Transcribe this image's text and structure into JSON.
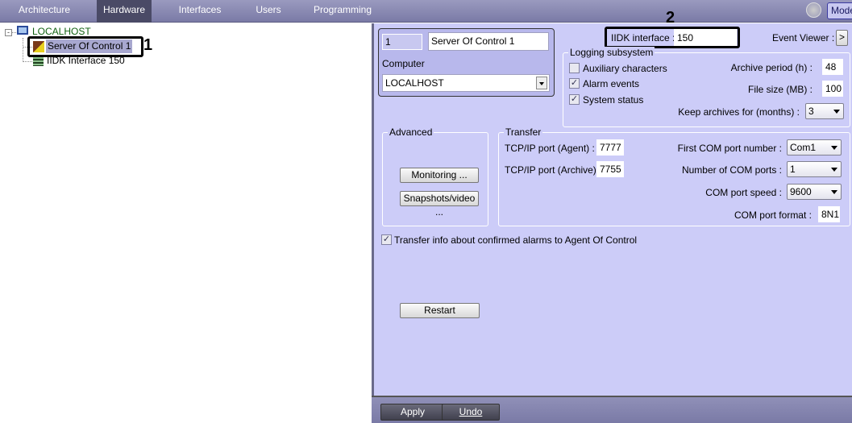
{
  "tabs": [
    {
      "label": "Architecture"
    },
    {
      "label": "Hardware",
      "active": true
    },
    {
      "label": "Interfaces"
    },
    {
      "label": "Users"
    },
    {
      "label": "Programming"
    }
  ],
  "topright": {
    "mode_label": "Mode"
  },
  "tree": {
    "root": "LOCALHOST",
    "items": [
      {
        "label": "Server Of Control 1",
        "selected": true
      },
      {
        "label": "IIDK Interface 150"
      }
    ]
  },
  "annotations": {
    "one": "1",
    "two": "2"
  },
  "panel": {
    "id": "1",
    "name": "Server Of Control 1",
    "computer_label": "Computer",
    "computer_value": "LOCALHOST",
    "iidk_label": "IIDK interface :",
    "iidk_value": "150",
    "event_viewer_label": "Event Viewer :",
    "event_viewer_button": ">",
    "logging": {
      "title": "Logging subsystem",
      "aux": {
        "label": "Auxiliary characters",
        "checked": false
      },
      "alarm": {
        "label": "Alarm events",
        "checked": true
      },
      "status": {
        "label": "System status",
        "checked": true
      },
      "archive_period_label": "Archive period (h) :",
      "archive_period": "48",
      "file_size_label": "File size (MB) :",
      "file_size": "100",
      "keep_label": "Keep archives for (months) :",
      "keep": "3"
    },
    "advanced": {
      "title": "Advanced",
      "monitoring": "Monitoring ...",
      "snapshots": "Snapshots/video ..."
    },
    "transfer": {
      "title": "Transfer",
      "agent_label": "TCP/IP port (Agent) :",
      "agent": "7777",
      "archive_label": "TCP/IP port (Archive) :",
      "archive": "7755",
      "first_com_label": "First COM port number :",
      "first_com": "Com1",
      "num_com_label": "Number of COM ports :",
      "num_com": "1",
      "speed_label": "COM port speed :",
      "speed": "9600",
      "format_label": "COM port format :",
      "format": "8N1"
    },
    "transfer_info": {
      "label": "Transfer info about confirmed alarms to Agent Of Control",
      "checked": true
    },
    "restart": "Restart"
  },
  "bottom": {
    "apply": "Apply",
    "undo": "Undo"
  },
  "colors": {
    "panel": "#ccccf8",
    "topbar": "#8a8ab2",
    "selection": "#a8a8d0"
  }
}
